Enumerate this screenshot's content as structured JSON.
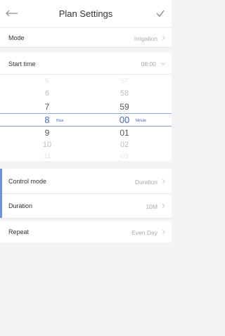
{
  "header": {
    "title": "Plan Settings"
  },
  "mode": {
    "label": "Mode",
    "value": "Irrigation"
  },
  "start_time": {
    "label": "Start time",
    "value": "08:00"
  },
  "picker": {
    "hours": [
      "5",
      "6",
      "7",
      "8",
      "9",
      "10",
      "11"
    ],
    "minutes": [
      "57",
      "58",
      "59",
      "00",
      "01",
      "02",
      "03"
    ],
    "hour_unit": "Hour",
    "minute_unit": "Minute"
  },
  "control_mode": {
    "label": "Control mode",
    "value": "Duration"
  },
  "duration": {
    "label": "Duration",
    "value": "10M"
  },
  "repeat": {
    "label": "Repeat",
    "value": "Even Day"
  },
  "colors": {
    "accent": "#4466c4",
    "background": "#f2f3f5",
    "card": "#ffffff"
  }
}
